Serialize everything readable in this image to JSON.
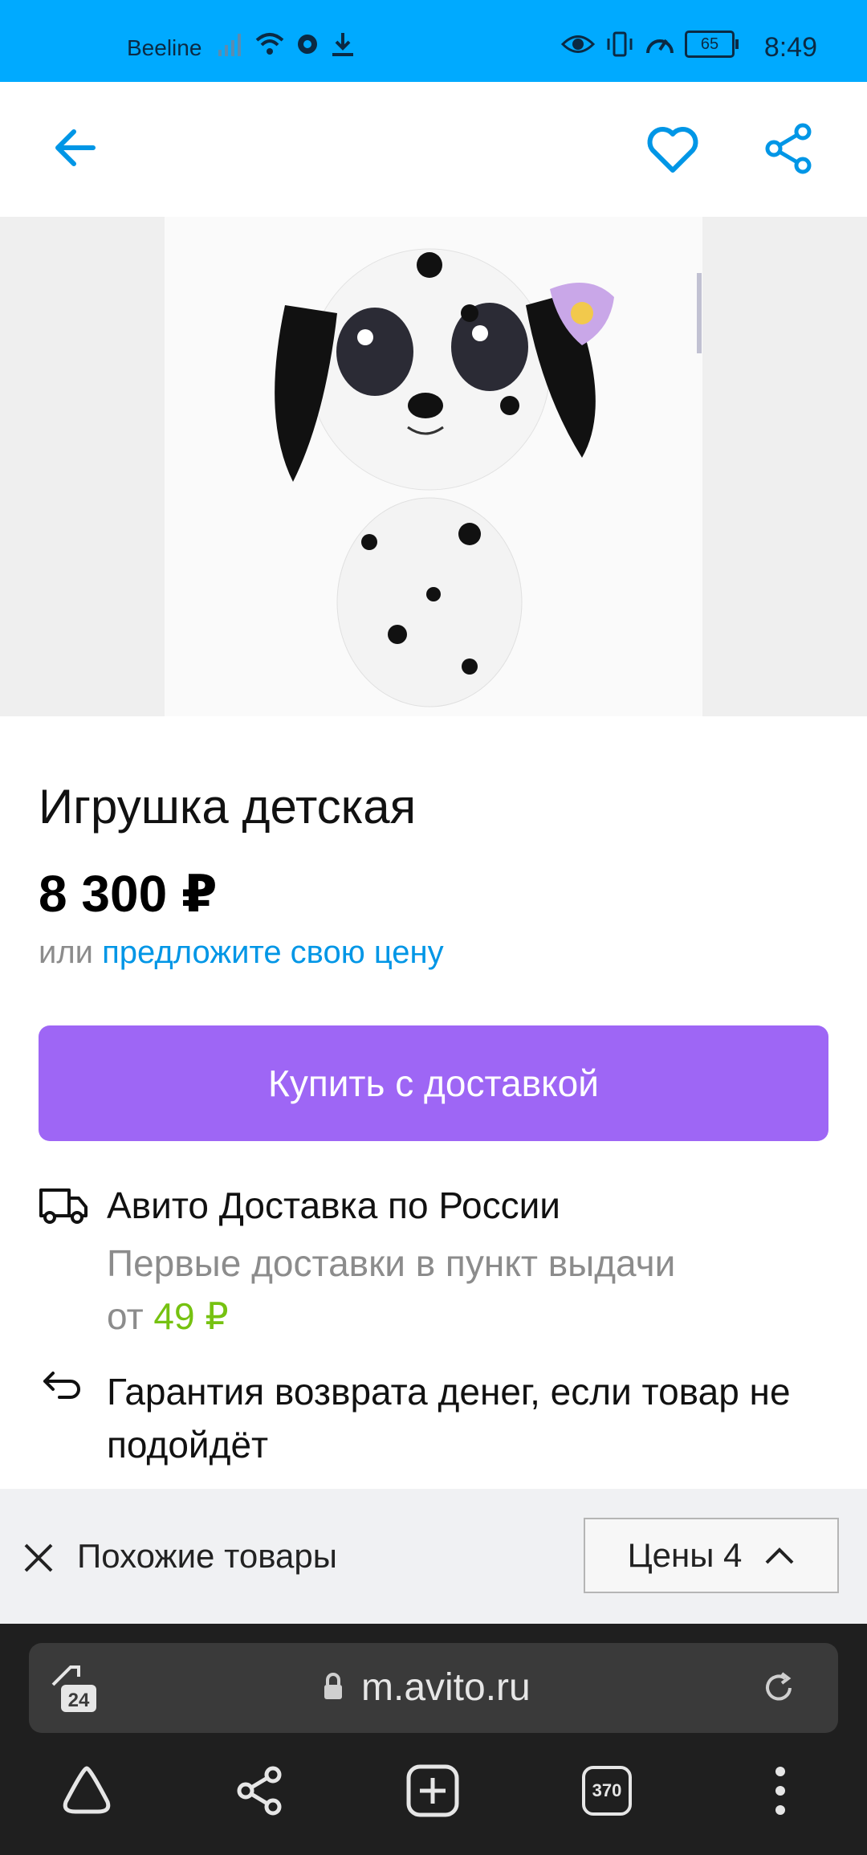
{
  "status_bar": {
    "carrier": "Beeline",
    "battery": "65",
    "time": "8:49",
    "icons": [
      "signal-icon",
      "wifi-icon",
      "settings-icon",
      "download-icon",
      "eye-icon",
      "vibrate-icon",
      "speed-icon",
      "battery-icon"
    ]
  },
  "top_nav": {
    "back_icon": "arrow-left-icon",
    "favorite_icon": "heart-icon",
    "share_icon": "share-icon"
  },
  "listing": {
    "title": "Игрушка детская",
    "price": "8 300 ₽",
    "offer_prefix": "или ",
    "offer_link": "предложите свою цену",
    "buy_button": "Купить с доставкой"
  },
  "delivery": {
    "title": "Авито Доставка по России",
    "subtitle": "Первые доставки в пункт выдачи",
    "from_prefix": "от ",
    "from_price": "49 ₽"
  },
  "guarantee": {
    "text": "Гарантия возврата денег, если товар не подойдёт"
  },
  "similar_bar": {
    "label": "Похожие товары",
    "prices_label": "Цены 4"
  },
  "browser": {
    "tabs_badge": "24",
    "url": "m.avito.ru",
    "tabs_count": "370"
  },
  "colors": {
    "status_bar": "#00aaff",
    "accent": "#0096e6",
    "buy_button": "#9e66f5",
    "green_price": "#76c211"
  }
}
